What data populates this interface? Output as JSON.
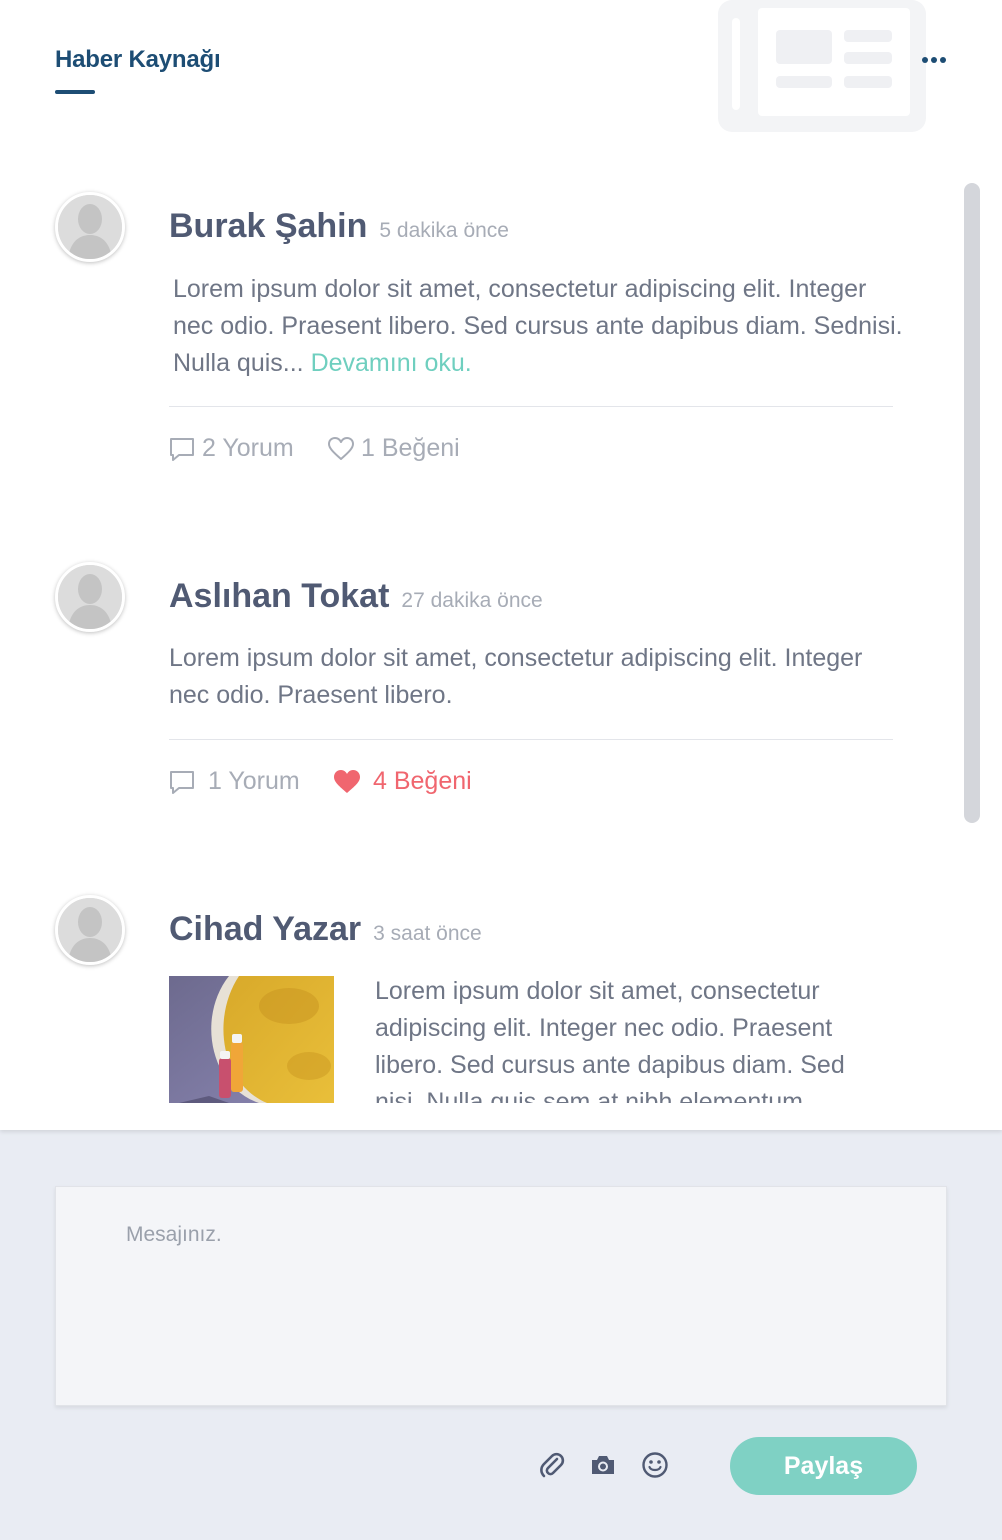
{
  "header": {
    "title": "Haber Kaynağı",
    "watermark_icon": "newspaper-icon",
    "more_icon": "more-horizontal-icon"
  },
  "posts": [
    {
      "author": "Burak Şahin",
      "time": "5 dakika önce",
      "text": "Lorem ipsum dolor sit amet, consectetur adipiscing  elit. Integer nec odio. Praesent libero. Sed cursus ante dapibus diam. Sednisi. Nulla quis... ",
      "read_more": "Devamını oku.",
      "comments": "2 Yorum",
      "likes": "1 Beğeni",
      "liked": false
    },
    {
      "author": "Aslıhan Tokat",
      "time": "27 dakika önce",
      "text": "Lorem ipsum dolor sit amet, consectetur adipiscing elit. Integer nec odio. Praesent libero.",
      "comments": "1 Yorum",
      "likes": "4 Beğeni",
      "liked": true
    },
    {
      "author": "Cihad Yazar",
      "time": "3 saat önce",
      "text": "Lorem ipsum dolor sit amet, consectetur adipiscing elit. Integer nec odio. Praesent libero. Sed cursus ante dapibus diam. Sed nisi. Nulla quis sem at nibh elementum"
    }
  ],
  "composer": {
    "placeholder": "Mesajınız.",
    "tools": [
      "paperclip-icon",
      "camera-icon",
      "smiley-icon"
    ],
    "share_label": "Paylaş"
  },
  "colors": {
    "accent": "#1d4d74",
    "link": "#6fcfbf",
    "like": "#f0666f",
    "share": "#7fd1c4",
    "background": "#e9ecf3"
  }
}
